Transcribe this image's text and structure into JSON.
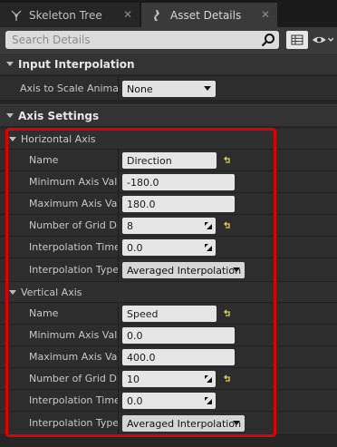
{
  "tabs": [
    {
      "label": "Skeleton Tree",
      "active": false
    },
    {
      "label": "Asset Details",
      "active": true
    }
  ],
  "search": {
    "placeholder": "Search Details"
  },
  "categories": {
    "input_interpolation": {
      "title": "Input Interpolation",
      "axis_to_scale_label": "Axis to Scale Animati",
      "axis_to_scale_value": "None"
    },
    "axis_settings": {
      "title": "Axis Settings",
      "horizontal": {
        "title": "Horizontal Axis",
        "name_label": "Name",
        "name_value": "Direction",
        "min_label": "Minimum Axis Valu",
        "min_value": "-180.0",
        "max_label": "Maximum Axis Val",
        "max_value": "180.0",
        "grid_label": "Number of Grid Divi",
        "grid_value": "8",
        "interp_time_label": "Interpolation Time",
        "interp_time_value": "0.0",
        "interp_type_label": "Interpolation Type",
        "interp_type_value": "Averaged Interpolation"
      },
      "vertical": {
        "title": "Vertical Axis",
        "name_label": "Name",
        "name_value": "Speed",
        "min_label": "Minimum Axis Valu",
        "min_value": "0.0",
        "max_label": "Maximum Axis Val",
        "max_value": "400.0",
        "grid_label": "Number of Grid Divi",
        "grid_value": "10",
        "interp_time_label": "Interpolation Time",
        "interp_time_value": "0.0",
        "interp_type_label": "Interpolation Type",
        "interp_type_value": "Averaged Interpolation"
      }
    }
  },
  "colors": {
    "highlight": "#e00000",
    "reset_arrow": "#e8d44d"
  }
}
